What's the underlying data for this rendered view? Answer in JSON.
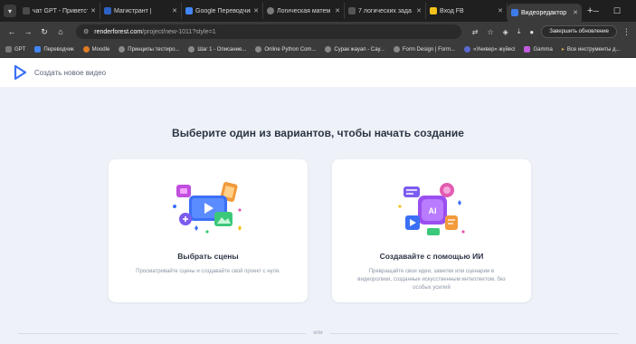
{
  "browser": {
    "tabs": [
      {
        "label": "чат GPT - Приветст",
        "color": "#4a4a4a"
      },
      {
        "label": "Магистрант |",
        "color": "#2b62c4"
      },
      {
        "label": "Google Переводчик",
        "color": "#4285f4"
      },
      {
        "label": "Логическая матем",
        "color": "#7a7a7a"
      },
      {
        "label": "7 логических зада",
        "color": "#555555"
      },
      {
        "label": "Вход FB",
        "color": "#f2c21b"
      },
      {
        "label": "Видеоредактор",
        "color": "#3d7be8"
      }
    ],
    "new_tab": "+",
    "url_host": "renderforest.com",
    "url_path": "/project/new-1011?style=1",
    "update_button": "Завершить обновление",
    "bookmarks": [
      {
        "label": "GPT",
        "color": "#777777"
      },
      {
        "label": "Переводчик",
        "color": "#4285f4"
      },
      {
        "label": "Moodle",
        "color": "#e27b24"
      },
      {
        "label": "Принципы тестиро...",
        "color": "#888888"
      },
      {
        "label": "Шаг 1 - Описание...",
        "color": "#888888"
      },
      {
        "label": "Online Python Com...",
        "color": "#888888"
      },
      {
        "label": "Сурак жауап - Сау...",
        "color": "#888888"
      },
      {
        "label": "Form Design | Form...",
        "color": "#888888"
      },
      {
        "label": "«Универ» жүйесі",
        "color": "#5b6ad0"
      },
      {
        "label": "Gamma",
        "color": "#c25be0"
      },
      {
        "label": "Все инструменты д...",
        "color": "#888888"
      }
    ]
  },
  "page": {
    "create_new_video": "Создать новое видео",
    "heading": "Выберите один из вариантов, чтобы начать создание",
    "cards": [
      {
        "title": "Выбрать сцены",
        "description": "Просматривайте сцены и создавайте свой проект с нуля."
      },
      {
        "title": "Создавайте с помощью ИИ",
        "description": "Превращайте свои идеи, заметки или сценарии в видеоролики, созданные искусственным интеллектом, без особых усилий"
      }
    ],
    "or_label": "или",
    "ai_badge": "AI"
  },
  "colors": {
    "accent": "#3b6ff5",
    "background": "#eef2f8"
  }
}
